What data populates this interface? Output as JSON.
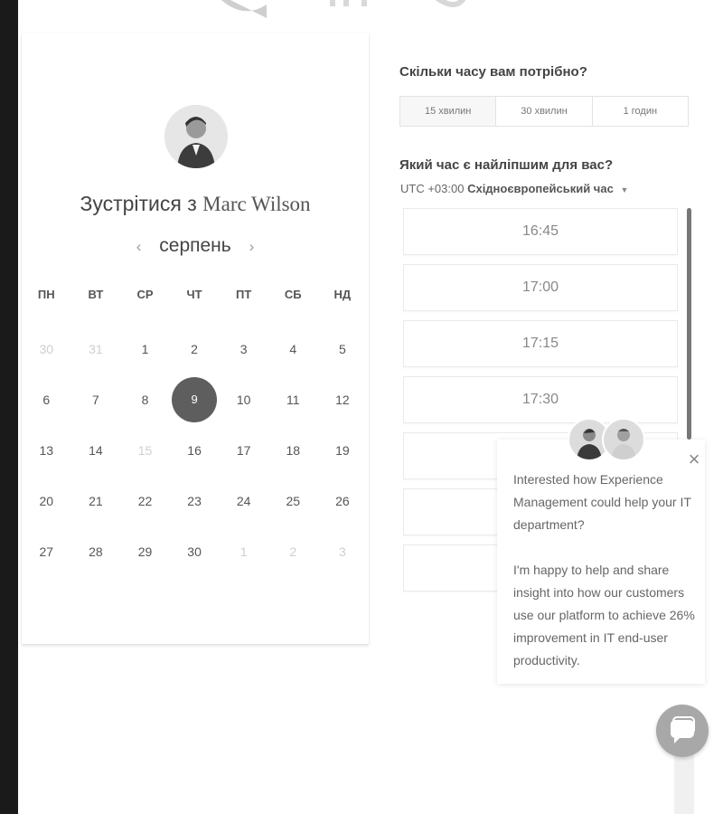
{
  "calendar": {
    "title_prefix": "Зустрітися з",
    "host_name": "Marc Wilson",
    "month": "серпень",
    "prev_icon": "chevron-left-icon",
    "next_icon": "chevron-right-icon",
    "weekdays": [
      "ПН",
      "ВТ",
      "СР",
      "ЧТ",
      "ПТ",
      "СБ",
      "НД"
    ],
    "weeks": [
      [
        {
          "d": "30",
          "muted": true
        },
        {
          "d": "31",
          "muted": true
        },
        {
          "d": "1"
        },
        {
          "d": "2"
        },
        {
          "d": "3"
        },
        {
          "d": "4"
        },
        {
          "d": "5"
        }
      ],
      [
        {
          "d": "6"
        },
        {
          "d": "7"
        },
        {
          "d": "8"
        },
        {
          "d": "9",
          "selected": true
        },
        {
          "d": "10"
        },
        {
          "d": "11"
        },
        {
          "d": "12"
        }
      ],
      [
        {
          "d": "13"
        },
        {
          "d": "14"
        },
        {
          "d": "15",
          "muted": true
        },
        {
          "d": "16"
        },
        {
          "d": "17"
        },
        {
          "d": "18"
        },
        {
          "d": "19"
        }
      ],
      [
        {
          "d": "20"
        },
        {
          "d": "21"
        },
        {
          "d": "22"
        },
        {
          "d": "23"
        },
        {
          "d": "24"
        },
        {
          "d": "25"
        },
        {
          "d": "26"
        }
      ],
      [
        {
          "d": "27"
        },
        {
          "d": "28"
        },
        {
          "d": "29"
        },
        {
          "d": "30"
        },
        {
          "d": "1",
          "muted": true
        },
        {
          "d": "2",
          "muted": true
        },
        {
          "d": "3",
          "muted": true
        }
      ]
    ]
  },
  "booking": {
    "duration_question": "Скільки часу вам потрібно?",
    "durations": [
      "15 хвилин",
      "30 хвилин",
      "1 годин"
    ],
    "active_duration": "15 хвилин",
    "time_question": "Який час є найліпшим для вас?",
    "tz_offset": "UTC +03:00",
    "tz_name": "Східноєвропейський час",
    "tz_caret_icon": "caret-down-icon",
    "slots": [
      "16:45",
      "17:00",
      "17:15",
      "17:30",
      "",
      "",
      ""
    ]
  },
  "chat": {
    "message_1": "Interested how Experience Management could help your IT department?",
    "message_2": "I'm happy to help and share insight into how our customers use our platform to achieve 26% improvement in IT end-user productivity.",
    "close_icon": "close-icon",
    "launcher_icon": "chat-bubble-icon"
  },
  "colors": {
    "selected_day": "#5e5e5e",
    "muted_day": "#cfcfcf",
    "chat_launcher": "#a8a8a8",
    "scrollbar": "#777777"
  }
}
